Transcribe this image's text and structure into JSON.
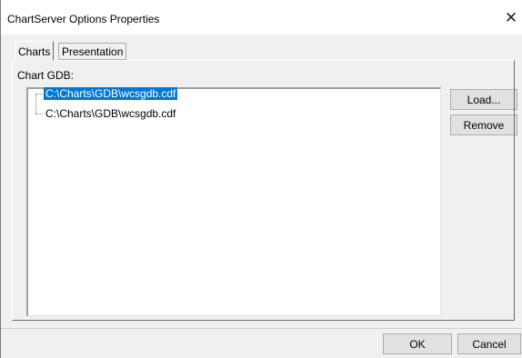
{
  "window": {
    "title": "ChartServer Options Properties",
    "close_glyph": "✕"
  },
  "tabs": [
    {
      "label": "Charts",
      "active": true
    },
    {
      "label": "Presentation",
      "active": false
    }
  ],
  "charts_tab": {
    "list_label": "Chart GDB:",
    "items": [
      {
        "label": "C:\\Charts\\GDB\\wcsgdb.cdf",
        "selected": true
      },
      {
        "label": "C:\\Charts\\GDB\\wcsgdb.cdf",
        "selected": false
      }
    ],
    "load_label": "Load...",
    "remove_label": "Remove"
  },
  "footer": {
    "ok_label": "OK",
    "cancel_label": "Cancel"
  },
  "colors": {
    "selection": "#0078d7",
    "dialog_bg": "#f0f0f0",
    "button_bg": "#e1e1e1"
  }
}
